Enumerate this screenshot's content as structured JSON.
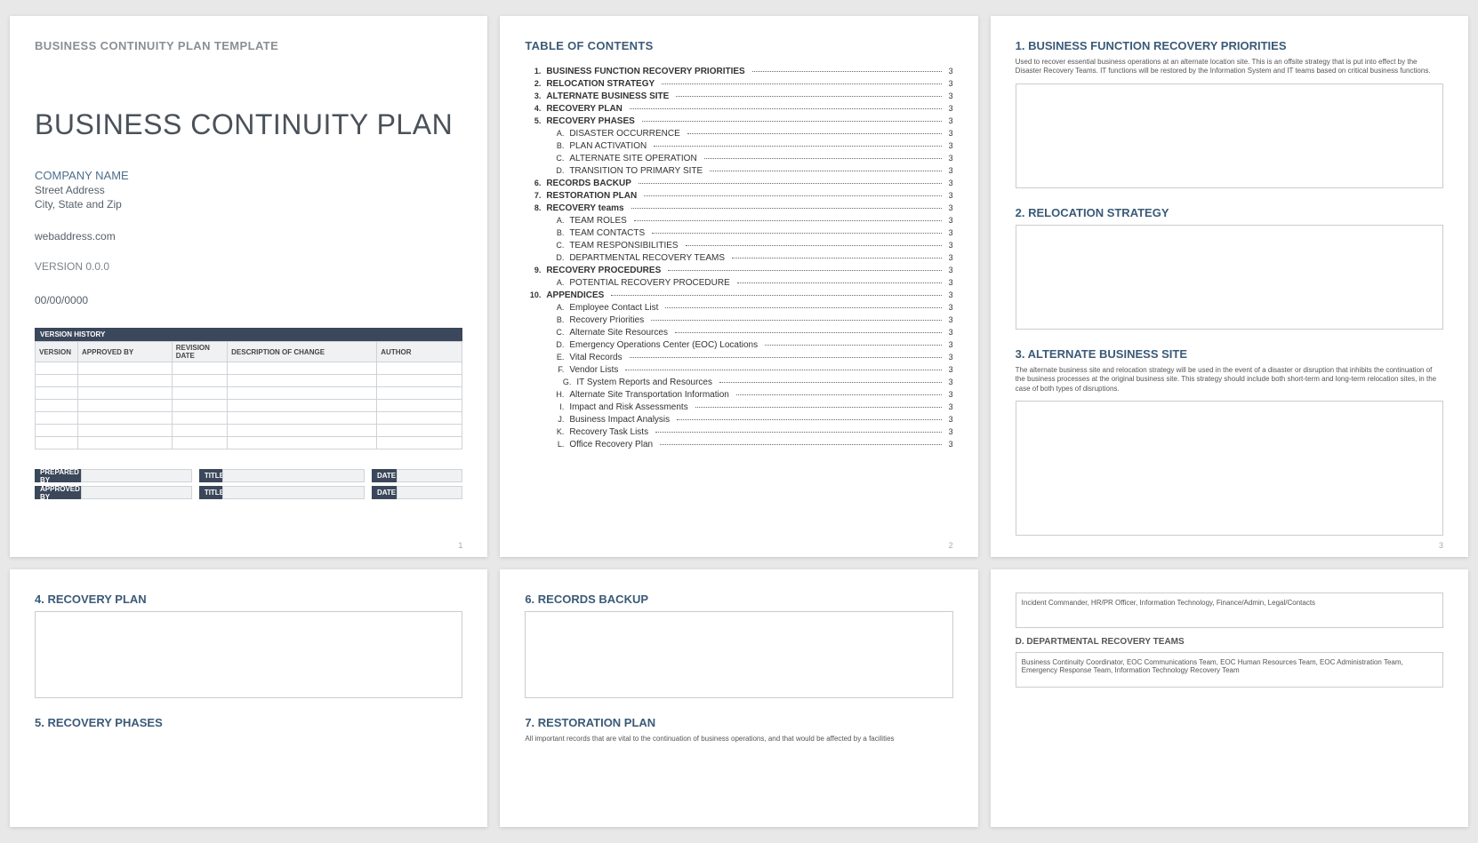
{
  "cover": {
    "template_label": "BUSINESS CONTINUITY PLAN TEMPLATE",
    "title": "BUSINESS CONTINUITY PLAN",
    "company_name": "COMPANY NAME",
    "addr1": "Street Address",
    "addr2": "City, State and Zip",
    "web": "webaddress.com",
    "version": "VERSION 0.0.0",
    "date": "00/00/0000",
    "vh_title": "VERSION HISTORY",
    "vh_headers": [
      "VERSION",
      "APPROVED BY",
      "REVISION DATE",
      "DESCRIPTION OF CHANGE",
      "AUTHOR"
    ],
    "sig_prepared": "PREPARED BY",
    "sig_approved": "APPROVED BY",
    "sig_title": "TITLE",
    "sig_date": "DATE"
  },
  "toc": {
    "heading": "TABLE OF CONTENTS",
    "items": [
      {
        "n": "1.",
        "label": "BUSINESS FUNCTION RECOVERY PRIORITIES",
        "pg": "3",
        "bold": true,
        "lvl": 0
      },
      {
        "n": "2.",
        "label": "RELOCATION STRATEGY",
        "pg": "3",
        "bold": true,
        "lvl": 0
      },
      {
        "n": "3.",
        "label": "ALTERNATE BUSINESS SITE",
        "pg": "3",
        "bold": true,
        "lvl": 0
      },
      {
        "n": "4.",
        "label": "RECOVERY PLAN",
        "pg": "3",
        "bold": true,
        "lvl": 0
      },
      {
        "n": "5.",
        "label": "RECOVERY PHASES",
        "pg": "3",
        "bold": true,
        "lvl": 0
      },
      {
        "n": "A.",
        "label": "DISASTER OCCURRENCE",
        "pg": "3",
        "lvl": 1
      },
      {
        "n": "B.",
        "label": "PLAN ACTIVATION",
        "pg": "3",
        "lvl": 1
      },
      {
        "n": "C.",
        "label": "ALTERNATE SITE OPERATION",
        "pg": "3",
        "lvl": 1
      },
      {
        "n": "D.",
        "label": "TRANSITION TO PRIMARY SITE",
        "pg": "3",
        "lvl": 1
      },
      {
        "n": "6.",
        "label": "RECORDS BACKUP",
        "pg": "3",
        "bold": true,
        "lvl": 0
      },
      {
        "n": "7.",
        "label": "RESTORATION PLAN",
        "pg": "3",
        "bold": true,
        "lvl": 0
      },
      {
        "n": "8.",
        "label": "RECOVERY teams",
        "pg": "3",
        "bold": true,
        "lvl": 0
      },
      {
        "n": "A.",
        "label": "TEAM ROLES",
        "pg": "3",
        "lvl": 1
      },
      {
        "n": "B.",
        "label": "TEAM CONTACTS",
        "pg": "3",
        "lvl": 1
      },
      {
        "n": "C.",
        "label": "TEAM RESPONSIBILITIES",
        "pg": "3",
        "lvl": 1
      },
      {
        "n": "D.",
        "label": "DEPARTMENTAL RECOVERY TEAMS",
        "pg": "3",
        "lvl": 1
      },
      {
        "n": "9.",
        "label": "RECOVERY PROCEDURES",
        "pg": "3",
        "bold": true,
        "lvl": 0
      },
      {
        "n": "A.",
        "label": "POTENTIAL RECOVERY PROCEDURE",
        "pg": "3",
        "lvl": 1
      },
      {
        "n": "10.",
        "label": "APPENDICES",
        "pg": "3",
        "bold": true,
        "lvl": 0
      },
      {
        "n": "A.",
        "label": "Employee Contact List",
        "pg": "3",
        "lvl": 1
      },
      {
        "n": "B.",
        "label": "Recovery Priorities",
        "pg": "3",
        "lvl": 1
      },
      {
        "n": "C.",
        "label": "Alternate Site Resources",
        "pg": "3",
        "lvl": 1
      },
      {
        "n": "D.",
        "label": "Emergency Operations Center (EOC) Locations",
        "pg": "3",
        "lvl": 1
      },
      {
        "n": "E.",
        "label": "Vital Records",
        "pg": "3",
        "lvl": 1
      },
      {
        "n": "F.",
        "label": "Vendor Lists",
        "pg": "3",
        "lvl": 1
      },
      {
        "n": "G.",
        "label": "IT System Reports and Resources",
        "pg": "3",
        "lvl": 2
      },
      {
        "n": "H.",
        "label": "Alternate Site Transportation Information",
        "pg": "3",
        "lvl": 1
      },
      {
        "n": "I.",
        "label": "Impact and Risk Assessments",
        "pg": "3",
        "lvl": 1
      },
      {
        "n": "J.",
        "label": "Business Impact Analysis",
        "pg": "3",
        "lvl": 1
      },
      {
        "n": "K.",
        "label": "Recovery Task Lists",
        "pg": "3",
        "lvl": 1
      },
      {
        "n": "L.",
        "label": "Office Recovery Plan",
        "pg": "3",
        "lvl": 1
      }
    ]
  },
  "p3": {
    "s1_head": "1.  BUSINESS FUNCTION RECOVERY PRIORITIES",
    "s1_desc": "Used to recover essential business operations at an alternate location site. This is an offsite strategy that is put into effect by the Disaster Recovery Teams. IT functions will be restored by the Information System and IT teams based on critical business functions.",
    "s2_head": "2.  RELOCATION STRATEGY",
    "s3_head": "3.  ALTERNATE BUSINESS SITE",
    "s3_desc": "The alternate business site and relocation strategy will be used in the event of a disaster or disruption that inhibits the continuation of the business processes at the original business site. This strategy should include both short-term and long-term relocation sites, in the case of both types of disruptions."
  },
  "p4": {
    "s4_head": "4.  RECOVERY PLAN",
    "s5_head": "5.  RECOVERY PHASES"
  },
  "p5": {
    "s6_head": "6.  RECORDS BACKUP",
    "s7_head": "7.  RESTORATION PLAN",
    "s7_desc": "All important records that are vital to the continuation of business operations, and that would be affected by a facilities"
  },
  "p6": {
    "boxA_text": "Incident Commander, HR/PR Officer, Information Technology, Finance/Admin, Legal/Contacts",
    "subD_head": "D.  DEPARTMENTAL RECOVERY TEAMS",
    "boxD_text": "Business Continuity Coordinator, EOC Communications Team, EOC Human Resources Team, EOC Administration Team, Emergency Response Team, Information Technology Recovery Team"
  },
  "pagenums": {
    "p1": "1",
    "p2": "2",
    "p3": "3"
  }
}
